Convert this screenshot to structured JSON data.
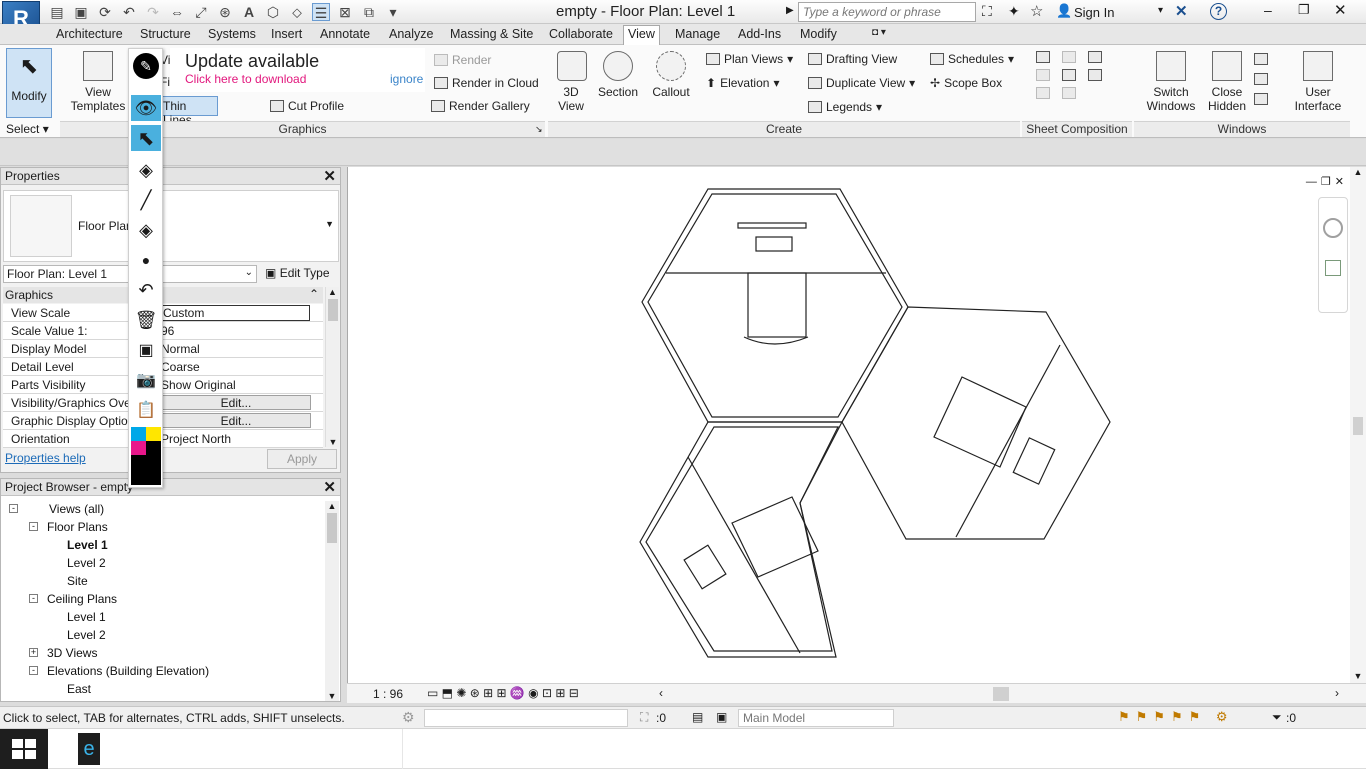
{
  "app": {
    "logo_letter": "R",
    "title": "empty - Floor Plan: Level 1",
    "search_placeholder": "Type a keyword or phrase",
    "sign_in": "Sign In"
  },
  "tabs": [
    "Architecture",
    "Structure",
    "Systems",
    "Insert",
    "Annotate",
    "Analyze",
    "Massing & Site",
    "Collaborate",
    "View",
    "Manage",
    "Add-Ins",
    "Modify"
  ],
  "active_tab": "View",
  "ribbon": {
    "modify": "Modify",
    "select": "Select",
    "view_templates": "View Templates",
    "visibility": "Vis",
    "filters": "Filt",
    "thin_lines": "Thin Lines",
    "cut_profile": "Cut Profile",
    "update_title": "Update available",
    "update_link": "Click here to download",
    "ignore": "ignore",
    "render": "Render",
    "render_cloud": "Render in Cloud",
    "render_gallery": "Render Gallery",
    "graphics_label": "Graphics",
    "view_3d": "3D View",
    "section": "Section",
    "callout": "Callout",
    "plan_views": "Plan Views",
    "elevation": "Elevation",
    "drafting_view": "Drafting View",
    "duplicate_view": "Duplicate View",
    "legends": "Legends",
    "schedules": "Schedules",
    "scope_box": "Scope Box",
    "create_label": "Create",
    "sheet_comp_label": "Sheet Composition",
    "switch_windows": "Switch Windows",
    "close_hidden": "Close Hidden",
    "user_interface": "User Interface",
    "windows_label": "Windows"
  },
  "properties": {
    "title": "Properties",
    "type_name": "Floor Plan",
    "instance_selector": "Floor Plan: Level 1",
    "edit_type": "Edit Type",
    "section_graphics": "Graphics",
    "rows": [
      {
        "k": "View Scale",
        "v": "Custom"
      },
      {
        "k": "Scale Value    1:",
        "v": "96"
      },
      {
        "k": "Display Model",
        "v": "Normal"
      },
      {
        "k": "Detail Level",
        "v": "Coarse"
      },
      {
        "k": "Parts Visibility",
        "v": "Show Original"
      },
      {
        "k": "Visibility/Graphics Ove",
        "v": "Edit..."
      },
      {
        "k": "Graphic Display Option",
        "v": "Edit..."
      },
      {
        "k": "Orientation",
        "v": "Project North"
      }
    ],
    "help": "Properties help",
    "apply": "Apply"
  },
  "browser": {
    "title": "Project Browser - empty",
    "items": [
      {
        "label": "Views (all)",
        "level": 0,
        "exp": "-"
      },
      {
        "label": "Floor Plans",
        "level": 1,
        "exp": "-"
      },
      {
        "label": "Level 1",
        "level": 2,
        "bold": true
      },
      {
        "label": "Level 2",
        "level": 2
      },
      {
        "label": "Site",
        "level": 2
      },
      {
        "label": "Ceiling Plans",
        "level": 1,
        "exp": "-"
      },
      {
        "label": "Level 1",
        "level": 2
      },
      {
        "label": "Level 2",
        "level": 2
      },
      {
        "label": "3D Views",
        "level": 1,
        "exp": "+"
      },
      {
        "label": "Elevations (Building Elevation)",
        "level": 1,
        "exp": "-"
      },
      {
        "label": "East",
        "level": 2
      }
    ]
  },
  "view_bar": {
    "scale": "1 : 96"
  },
  "status": {
    "hint": "Click to select, TAB for alternates, CTRL adds, SHIFT unselects.",
    "count": ":0",
    "model": "Main Model",
    "filter": ":0"
  }
}
